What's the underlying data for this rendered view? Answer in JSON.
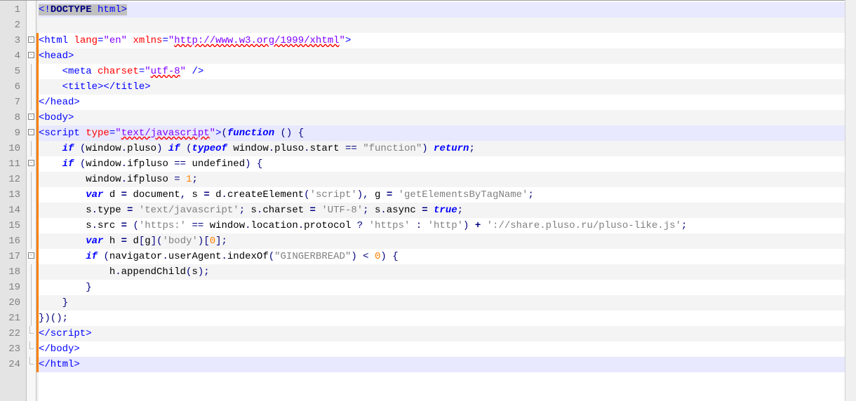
{
  "lineCount": 24,
  "highlightedLines": [
    1,
    9,
    24
  ],
  "changedLines": [
    3,
    4,
    5,
    6,
    7,
    8,
    9,
    10,
    11,
    12,
    13,
    14,
    15,
    16,
    17,
    18,
    19,
    20,
    21,
    22,
    23,
    24
  ],
  "fold": {
    "open": [
      3,
      4,
      8,
      9,
      11,
      17
    ],
    "cont": [
      5,
      6,
      7,
      10,
      12,
      13,
      14,
      15,
      16,
      18,
      19,
      20,
      21
    ],
    "end": [
      22,
      23,
      24
    ]
  },
  "code": [
    {
      "n": 1,
      "html": "<span class='sel'><span class='t-tag'>&lt;!</span><span class='t-kw2'>DOCTYPE</span><span class='t-tag'> html&gt;</span></span>"
    },
    {
      "n": 2,
      "html": ""
    },
    {
      "n": 3,
      "html": "<span class='t-tag'>&lt;html</span> <span class='t-attr'>lang</span><span class='t-tag'>=</span><span class='t-str'>\"en\"</span> <span class='t-attr'>xmlns</span><span class='t-tag'>=</span><span class='t-str'>\"<span class='ul'>http://www.w3.org/1999/xhtml</span>\"</span><span class='t-tag'>&gt;</span>"
    },
    {
      "n": 4,
      "html": "<span class='t-tag'>&lt;head&gt;</span>"
    },
    {
      "n": 5,
      "html": "    <span class='t-tag'>&lt;meta</span> <span class='t-attr'>charset</span><span class='t-tag'>=</span><span class='t-str'>\"<span class='ul'>utf-8</span>\"</span> <span class='t-tag'>/&gt;</span>"
    },
    {
      "n": 6,
      "html": "    <span class='t-tag'>&lt;title&gt;&lt;/title&gt;</span>"
    },
    {
      "n": 7,
      "html": "<span class='t-tag'>&lt;/head&gt;</span>"
    },
    {
      "n": 8,
      "html": "<span class='t-tag'>&lt;body&gt;</span>"
    },
    {
      "n": 9,
      "html": "<span class='t-tag'>&lt;script</span> <span class='t-attr'>type</span><span class='t-tag'>=</span><span class='t-str'>\"<span class='ul'>text/javascript</span>\"</span><span class='t-tag'>&gt;</span><span class='t-op'>(</span><span class='t-kw'>function</span> <span class='t-op'>()</span> <span class='t-op'>{</span>"
    },
    {
      "n": 10,
      "html": "    <span class='t-kw'>if</span> <span class='t-op'>(</span>window<span class='t-op'>.</span>pluso<span class='t-op'>)</span> <span class='t-kw'>if</span> <span class='t-op'>(</span><span class='t-kw'>typeof</span> window<span class='t-op'>.</span>pluso<span class='t-op'>.</span>start <span class='t-op'>==</span> <span class='t-strd'>\"function\"</span><span class='t-op'>)</span> <span class='t-kw'>return</span><span class='t-op'>;</span>"
    },
    {
      "n": 11,
      "html": "    <span class='t-kw'>if</span> <span class='t-op'>(</span>window<span class='t-op'>.</span>ifpluso <span class='t-op'>==</span> undefined<span class='t-op'>)</span> <span class='t-op'>{</span>"
    },
    {
      "n": 12,
      "html": "        window<span class='t-op'>.</span>ifpluso <span class='t-op'>=</span> <span class='t-num'>1</span><span class='t-op'>;</span>"
    },
    {
      "n": 13,
      "html": "        <span class='t-kw'>var</span> d <span class='t-kw2'>=</span> document<span class='t-op'>,</span> s <span class='t-kw2'>=</span> d<span class='t-op'>.</span>createElement<span class='t-op'>(</span><span class='t-strd'>'script'</span><span class='t-op'>),</span> g <span class='t-kw2'>=</span> <span class='t-strd'>'getElementsByTagName'</span><span class='t-op'>;</span>"
    },
    {
      "n": 14,
      "html": "        s<span class='t-op'>.</span>type <span class='t-kw2'>=</span> <span class='t-strd'>'text/javascript'</span><span class='t-op'>;</span> s<span class='t-op'>.</span>charset <span class='t-kw2'>=</span> <span class='t-strd'>'UTF-8'</span><span class='t-op'>;</span> s<span class='t-op'>.</span>async <span class='t-kw2'>=</span> <span class='t-kw'>true</span><span class='t-op'>;</span>"
    },
    {
      "n": 15,
      "html": "        s<span class='t-op'>.</span>src <span class='t-kw2'>=</span> <span class='t-op'>(</span><span class='t-strd'>'https:'</span> <span class='t-op'>==</span> window<span class='t-op'>.</span>location<span class='t-op'>.</span>protocol <span class='t-op'>?</span> <span class='t-strd'>'https'</span> <span class='t-op'>:</span> <span class='t-strd'>'http'</span><span class='t-op'>)</span> <span class='t-kw2'>+</span> <span class='t-strd'>'://share.pluso.ru/pluso-like.js'</span><span class='t-op'>;</span>"
    },
    {
      "n": 16,
      "html": "        <span class='t-kw'>var</span> h <span class='t-kw2'>=</span> d<span class='t-op'>[</span>g<span class='t-op'>](</span><span class='t-strd'>'body'</span><span class='t-op'>)[</span><span class='t-num'>0</span><span class='t-op'>];</span>"
    },
    {
      "n": 17,
      "html": "        <span class='t-kw'>if</span> <span class='t-op'>(</span>navigator<span class='t-op'>.</span>userAgent<span class='t-op'>.</span>indexOf<span class='t-op'>(</span><span class='t-strd'>\"GINGERBREAD\"</span><span class='t-op'>)</span> <span class='t-op'>&lt;</span> <span class='t-num'>0</span><span class='t-op'>)</span> <span class='t-op'>{</span>"
    },
    {
      "n": 18,
      "html": "            h<span class='t-op'>.</span>appendChild<span class='t-op'>(</span>s<span class='t-op'>);</span>"
    },
    {
      "n": 19,
      "html": "        <span class='t-op'>}</span>"
    },
    {
      "n": 20,
      "html": "    <span class='t-op'>}</span>"
    },
    {
      "n": 21,
      "html": "<span class='t-op'>})();</span>"
    },
    {
      "n": 22,
      "html": "<span class='t-tag'>&lt;/script&gt;</span>"
    },
    {
      "n": 23,
      "html": "<span class='t-tag'>&lt;/body&gt;</span>"
    },
    {
      "n": 24,
      "html": "<span class='t-tag'>&lt;/html&gt;</span>"
    }
  ]
}
